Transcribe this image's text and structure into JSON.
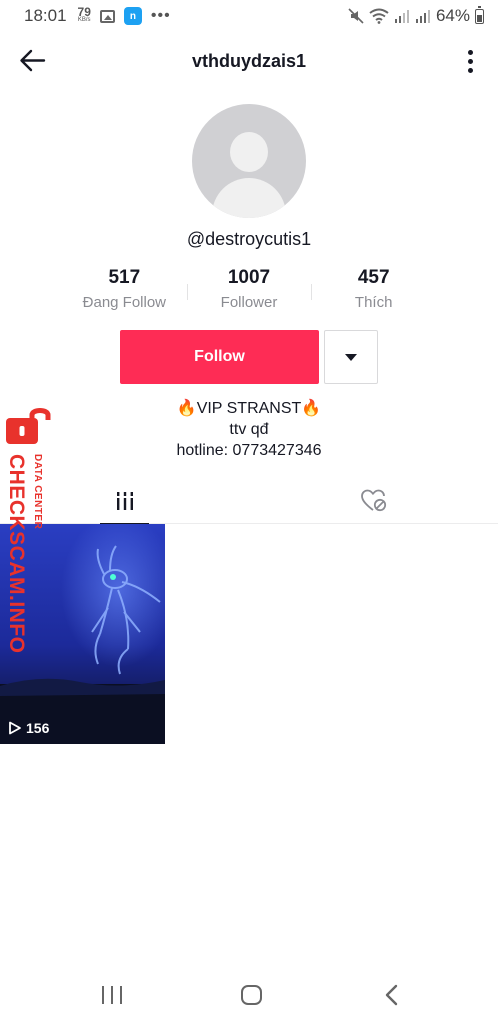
{
  "status_bar": {
    "time": "18:01",
    "net_speed": "79",
    "net_unit": "KB/s",
    "app_icon": "n",
    "dots": "•••",
    "battery": "64%"
  },
  "header": {
    "title": "vthduydzais1",
    "back_icon": "arrow-left-icon",
    "menu_icon": "more-vertical-icon"
  },
  "profile": {
    "username": "@destroycutis1",
    "stats": [
      {
        "value": "517",
        "label": "Đang Follow"
      },
      {
        "value": "1007",
        "label": "Follower"
      },
      {
        "value": "457",
        "label": "Thích"
      }
    ],
    "follow_label": "Follow",
    "bio_lines": [
      "🔥VIP STRANST🔥",
      "ttv qđ",
      "hotline: 0773427346"
    ]
  },
  "tabs": [
    {
      "icon": "grid-icon",
      "active": true
    },
    {
      "icon": "liked-hidden-icon",
      "active": false
    }
  ],
  "videos": [
    {
      "views": "156"
    }
  ],
  "watermark": {
    "main": "CHECKSCAM.INFO",
    "sub": "DATA CENTER"
  },
  "colors": {
    "follow": "#fe2c55",
    "watermark": "#e8322c"
  }
}
